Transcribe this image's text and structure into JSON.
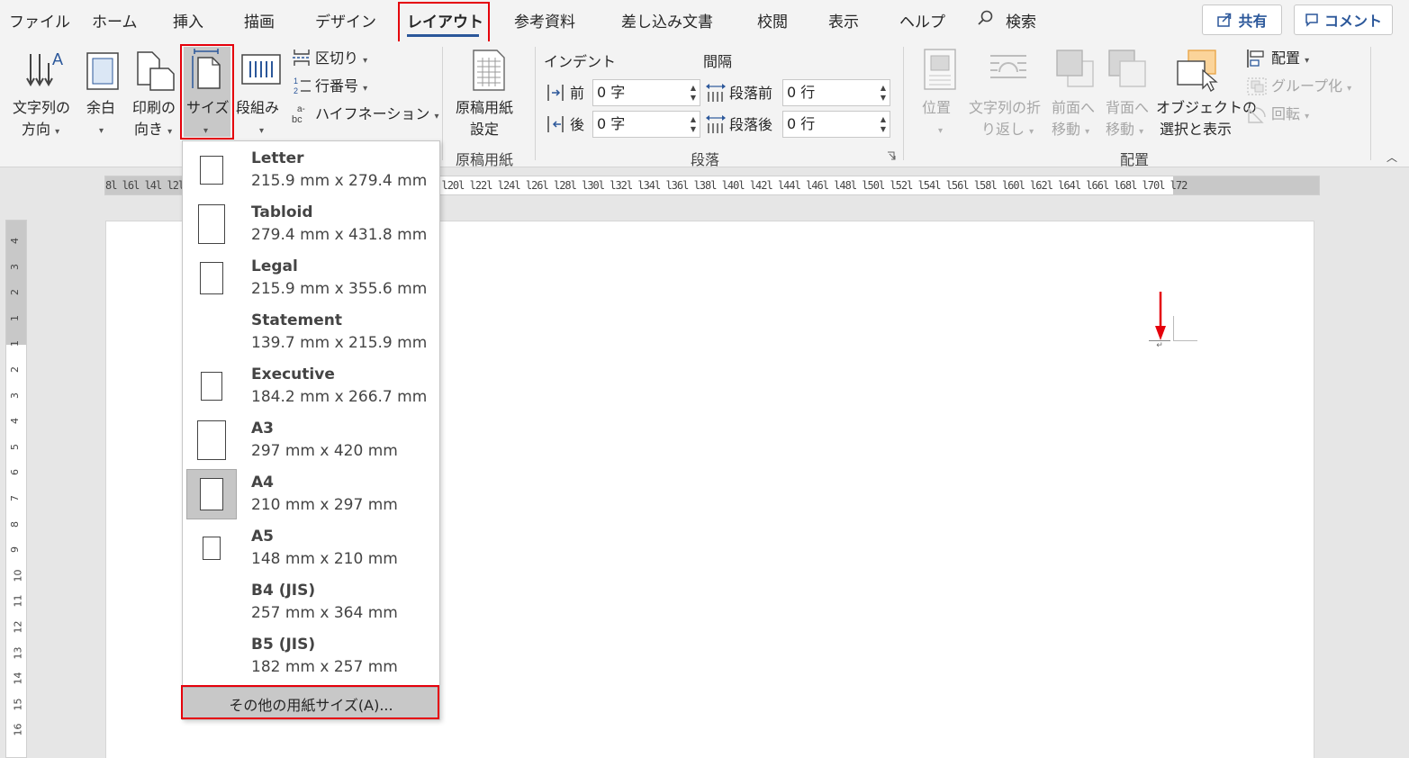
{
  "tabs": [
    "ファイル",
    "ホーム",
    "挿入",
    "描画",
    "デザイン",
    "レイアウト",
    "参考資料",
    "差し込み文書",
    "校閲",
    "表示",
    "ヘルプ",
    "検索"
  ],
  "top_buttons": {
    "share": "共有",
    "comment": "コメント"
  },
  "ribbon": {
    "text_direction": [
      "文字列の",
      "方向"
    ],
    "margins": "余白",
    "orientation": [
      "印刷の",
      "向き"
    ],
    "size": "サイズ",
    "columns": "段組み",
    "breaks": "区切り",
    "line_numbers": "行番号",
    "hyphenation": "ハイフネーション",
    "genko": [
      "原稿用紙",
      "設定"
    ],
    "group_genko": "原稿用紙",
    "indent_label": "インデント",
    "spacing_label": "間隔",
    "indent_before_label": "前",
    "indent_before_value": "0 字",
    "indent_after_label": "後",
    "indent_after_value": "0 字",
    "space_before_label": "段落前",
    "space_before_value": "0 行",
    "space_after_label": "段落後",
    "space_after_value": "0 行",
    "group_paragraph": "段落",
    "position": "位置",
    "wrap_text": [
      "文字列の折",
      "り返し"
    ],
    "bring_forward": [
      "前面へ",
      "移動"
    ],
    "send_backward": [
      "背面へ",
      "移動"
    ],
    "selection_pane": [
      "オブジェクトの",
      "選択と表示"
    ],
    "align": "配置",
    "group": "グループ化",
    "rotate": "回転",
    "group_arrange": "配置"
  },
  "ruler_ticks": "8l  l6l  l4l  l2l  l l  l2l  l4l  l6l  l8l  l10l  l12l  l14l  l16l  l18l  l20l  l22l  l24l  l26l  l28l  l30l  l32l  l34l  l36l  l38l  l40l  l42l  l44l  l46l  l48l  l50l  l52l  l54l  l56l  l58l  l60l  l62l  l64l  l66l  l68l  l70l  l72",
  "vruler_numbers": [
    "4",
    "3",
    "2",
    "1",
    "1",
    "2",
    "3",
    "4",
    "5",
    "6",
    "7",
    "8",
    "9",
    "10",
    "11",
    "12",
    "13",
    "14",
    "15",
    "16"
  ],
  "paper_sizes": [
    {
      "name": "Letter",
      "dims": "215.9 mm x 279.4 mm",
      "icon": "portrait"
    },
    {
      "name": "Tabloid",
      "dims": "279.4 mm x 431.8 mm",
      "icon": "portrait"
    },
    {
      "name": "Legal",
      "dims": "215.9 mm x 355.6 mm",
      "icon": "portrait"
    },
    {
      "name": "Statement",
      "dims": "139.7 mm x 215.9 mm",
      "icon": "none"
    },
    {
      "name": "Executive",
      "dims": "184.2 mm x 266.7 mm",
      "icon": "portrait"
    },
    {
      "name": "A3",
      "dims": "297 mm x 420 mm",
      "icon": "portrait"
    },
    {
      "name": "A4",
      "dims": "210 mm x 297 mm",
      "icon": "portrait",
      "selected": true
    },
    {
      "name": "A5",
      "dims": "148 mm x 210 mm",
      "icon": "portrait"
    },
    {
      "name": "B4 (JIS)",
      "dims": "257 mm x 364 mm",
      "icon": "none"
    },
    {
      "name": "B5 (JIS)",
      "dims": "182 mm x 257 mm",
      "icon": "none"
    }
  ],
  "more_paper_sizes": "その他の用紙サイズ(A)...",
  "colors": {
    "accent": "#2b579a",
    "highlight": "#e5000b"
  }
}
